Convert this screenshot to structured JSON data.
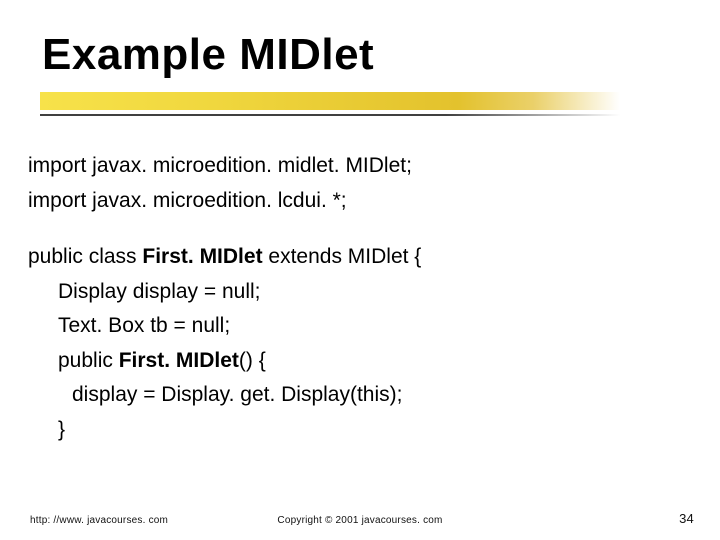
{
  "title": "Example MIDlet",
  "code": {
    "line1": "import javax. microedition. midlet. MIDlet;",
    "line2": "import javax. microedition. lcdui. *;",
    "line3_pre": "public class ",
    "line3_bold": "First. MIDlet",
    "line3_post": " extends MIDlet {",
    "line4": "Display display = null;",
    "line5": "Text. Box tb = null;",
    "line6_pre": "public ",
    "line6_bold": "First. MIDlet",
    "line6_post": "() {",
    "line7": "display = Display. get. Display(this);",
    "line8": "}"
  },
  "footer": {
    "left": "http: //www. javacourses. com",
    "center": "Copyright © 2001 javacourses. com",
    "right": "34"
  }
}
